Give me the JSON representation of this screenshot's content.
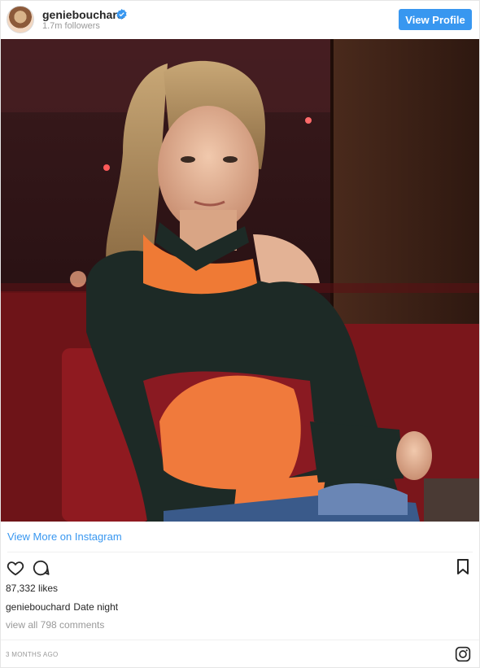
{
  "header": {
    "username": "geniebouchard",
    "followers": "1.7m followers",
    "view_profile_label": "View Profile"
  },
  "post": {
    "view_more_label": "View More on Instagram",
    "likes": "87,332 likes",
    "caption_user": "geniebouchard",
    "caption_text": "Date night",
    "comments_link": "view all 798 comments",
    "time_ago": "3 MONTHS AGO"
  },
  "icons": {
    "verified": "verified-badge-icon",
    "like": "heart-icon",
    "comment": "comment-bubble-icon",
    "save": "bookmark-icon",
    "brand": "instagram-logo-icon"
  },
  "colors": {
    "accent": "#3897f0",
    "text": "#262626",
    "muted": "#999999"
  }
}
